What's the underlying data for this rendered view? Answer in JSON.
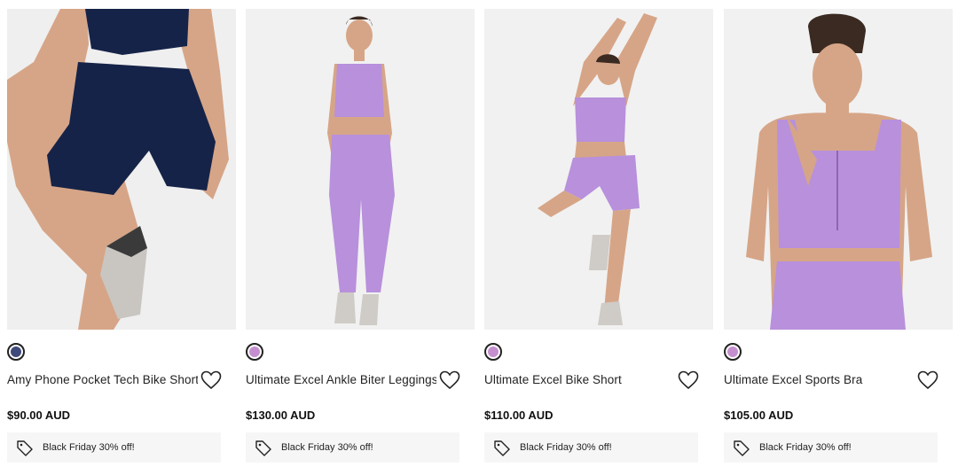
{
  "products": [
    {
      "name": "Amy Phone Pocket Tech Bike Short",
      "price": "$90.00 AUD",
      "promo": "Black Friday 30% off!",
      "swatch_color": "#3f4a7a",
      "garment_color": "#162348"
    },
    {
      "name": "Ultimate Excel Ankle Biter Leggings",
      "price": "$130.00 AUD",
      "promo": "Black Friday 30% off!",
      "swatch_color": "#c58fcf",
      "garment_color": "#b890dc"
    },
    {
      "name": "Ultimate Excel Bike Short",
      "price": "$110.00 AUD",
      "promo": "Black Friday 30% off!",
      "swatch_color": "#c58fcf",
      "garment_color": "#b890dc"
    },
    {
      "name": "Ultimate Excel Sports Bra",
      "price": "$105.00 AUD",
      "promo": "Black Friday 30% off!",
      "swatch_color": "#c58fcf",
      "garment_color": "#b890dc"
    }
  ],
  "icons": {
    "wishlist": "heart-icon",
    "promo": "tag-icon"
  }
}
